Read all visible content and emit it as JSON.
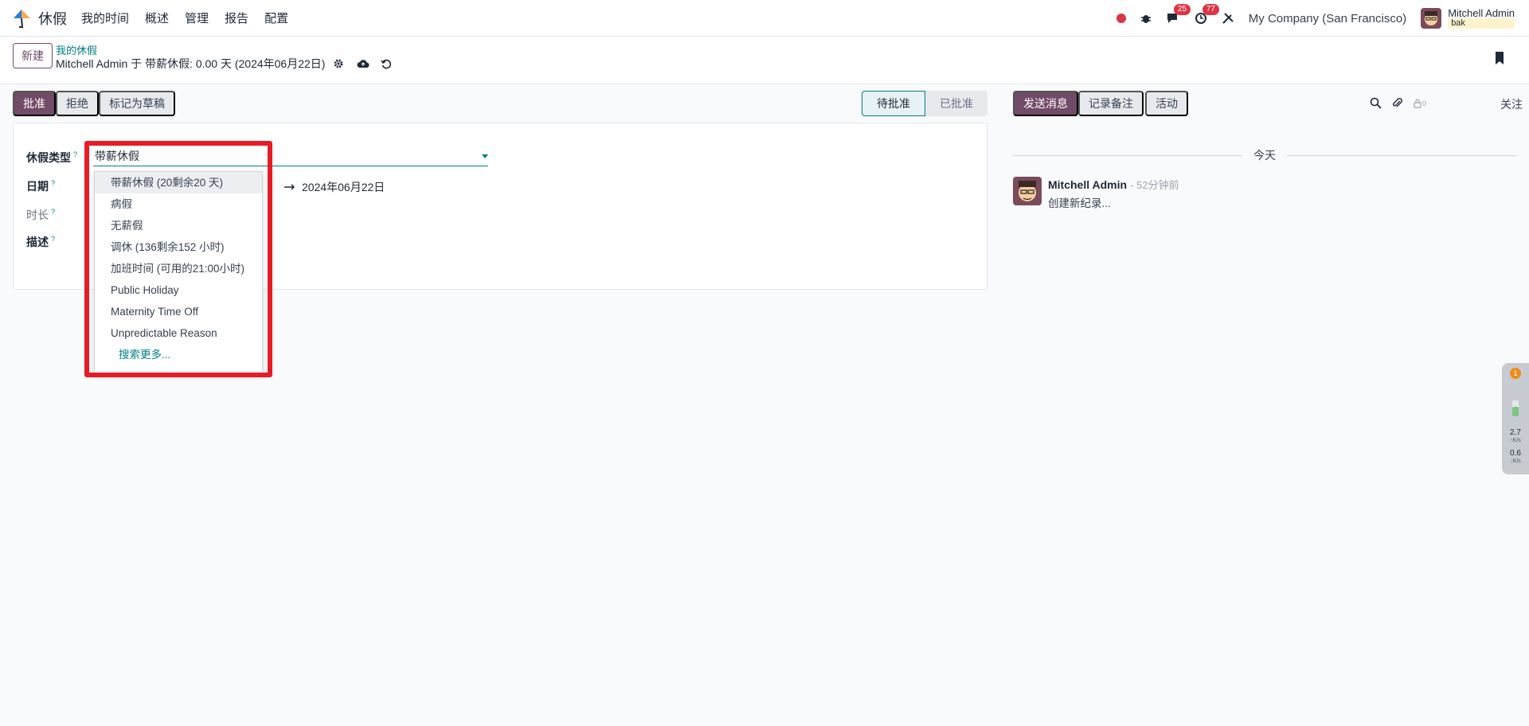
{
  "navbar": {
    "app_name": "休假",
    "menu": [
      "我的时间",
      "概述",
      "管理",
      "报告",
      "配置"
    ],
    "chat_badge": "25",
    "activity_badge": "77",
    "company": "My Company (San Francisco)",
    "user_name": "Mitchell Admin",
    "user_db": "bak"
  },
  "control_panel": {
    "new_button": "新建",
    "breadcrumb": "我的休假",
    "record_title": "Mitchell Admin 于 带薪休假: 0.00 天 (2024年06月22日)"
  },
  "statusbar": {
    "approve": "批准",
    "refuse": "拒绝",
    "draft": "标记为草稿",
    "stages": [
      "待批准",
      "已批准"
    ]
  },
  "form": {
    "leave_type_label": "休假类型",
    "leave_type_value": "带薪休假",
    "date_label": "日期",
    "date_to": "2024年06月22日",
    "duration_label": "时长",
    "description_label": "描述",
    "help_mark": "?"
  },
  "dropdown": {
    "options": [
      "带薪休假 (20剩余20 天)",
      "病假",
      "无薪假",
      "调休 (136剩余152 小时)",
      "加班时间 (可用的21:00小时)",
      "Public Holiday",
      "Maternity Time Off",
      "Unpredictable Reason"
    ],
    "search_more": "搜索更多..."
  },
  "chatter": {
    "send_message": "发送消息",
    "log_note": "记录备注",
    "activity": "活动",
    "follower_count": "0",
    "follow": "关注",
    "today": "今天",
    "message": {
      "author": "Mitchell Admin",
      "time": "- 52分钟前",
      "text": "创建新纪录..."
    }
  },
  "side_widget": {
    "badge": "1",
    "up_value": "2.7",
    "up_unit": "K/s",
    "down_value": "0.6",
    "down_unit": "K/s"
  },
  "colors": {
    "primary": "#714b67",
    "teal": "#017e84",
    "highlight": "#e81b24"
  }
}
